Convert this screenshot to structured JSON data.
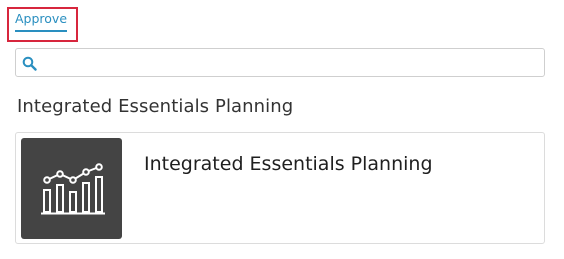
{
  "tabs": {
    "approve_label": "Approve"
  },
  "search": {
    "value": "",
    "placeholder": "",
    "icon": "search-icon"
  },
  "section": {
    "title": "Integrated Essentials Planning"
  },
  "card": {
    "title": "Integrated Essentials Planning",
    "icon": "chart-bars-icon"
  },
  "colors": {
    "accent": "#2a8fc0",
    "highlight_border": "#d7263d",
    "thumbnail_bg": "#444444"
  }
}
